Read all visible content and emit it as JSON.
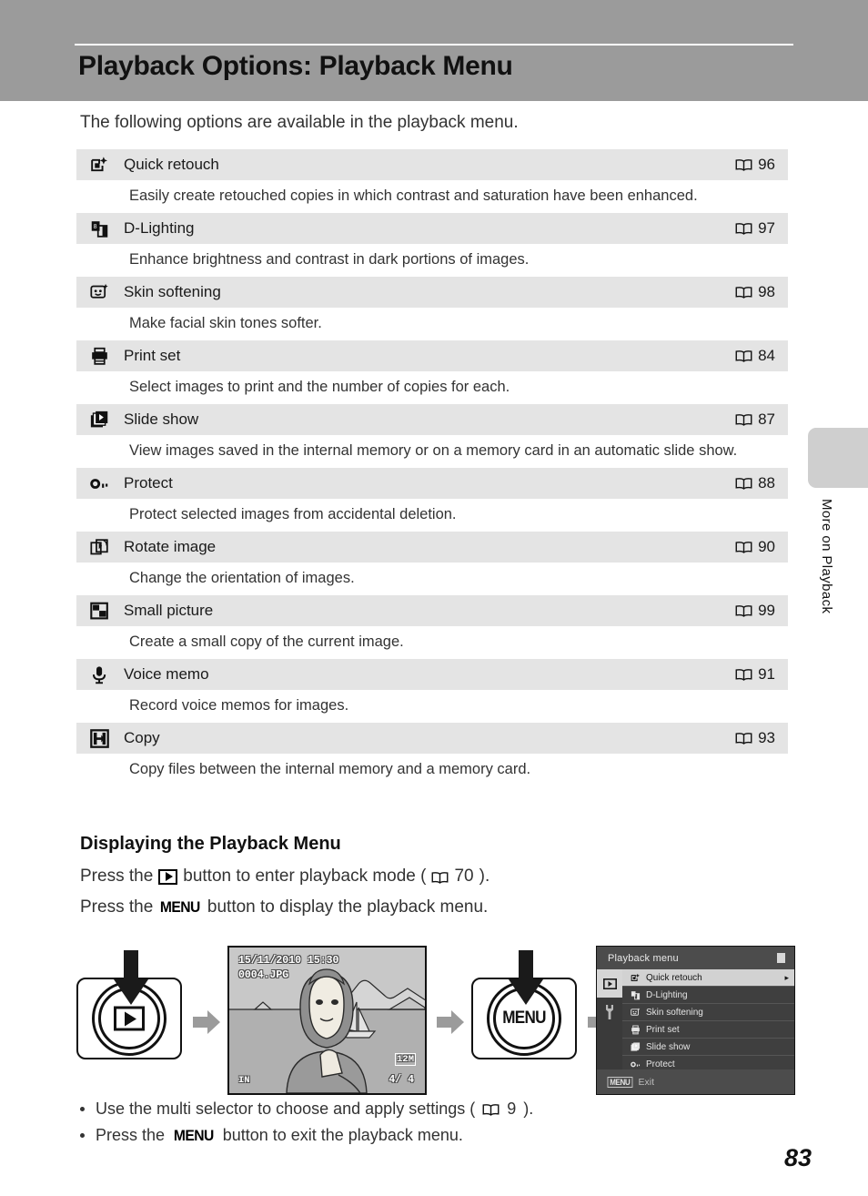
{
  "header": {
    "title": "Playback Options: Playback Menu",
    "band_color": "#9b9b9b"
  },
  "intro": "The following options are available in the playback menu.",
  "options_table": {
    "rows": [
      {
        "icon": "quick-retouch-icon",
        "label": "Quick retouch",
        "page": "96",
        "description": "Easily create retouched copies in which contrast and saturation have been enhanced."
      },
      {
        "icon": "d-lighting-icon",
        "label": "D-Lighting",
        "page": "97",
        "description": "Enhance brightness and contrast in dark portions of images."
      },
      {
        "icon": "skin-softening-icon",
        "label": "Skin softening",
        "page": "98",
        "description": "Make facial skin tones softer."
      },
      {
        "icon": "print-set-icon",
        "label": "Print set",
        "page": "84",
        "description": "Select images to print and the number of copies for each."
      },
      {
        "icon": "slide-show-icon",
        "label": "Slide show",
        "page": "87",
        "description": "View images saved in the internal memory or on a memory card in an automatic slide show."
      },
      {
        "icon": "protect-key-icon",
        "label": "Protect",
        "page": "88",
        "description": "Protect selected images from accidental deletion."
      },
      {
        "icon": "rotate-image-icon",
        "label": "Rotate image",
        "page": "90",
        "description": "Change the orientation of images."
      },
      {
        "icon": "small-picture-icon",
        "label": "Small picture",
        "page": "99",
        "description": "Create a small copy of the current image."
      },
      {
        "icon": "voice-memo-icon",
        "label": "Voice memo",
        "page": "91",
        "description": "Record voice memos for images."
      },
      {
        "icon": "copy-icon",
        "label": "Copy",
        "page": "93",
        "description": "Copy files between the internal memory and a memory card."
      }
    ]
  },
  "section": {
    "heading": "Displaying the Playback Menu",
    "line1_pre": "Press the",
    "line1_mid": "button to enter playback mode (",
    "line1_page": "70",
    "line1_post": ").",
    "line2_pre": "Press the",
    "line2_menu": "MENU",
    "line2_post": "button to display the playback menu."
  },
  "figure": {
    "play_button_label": "",
    "menu_button_label": "MENU",
    "camera_screen": {
      "date": "15/11/2010 15:30",
      "filename": "0004.JPG",
      "image_size": "12M",
      "memory": "IN",
      "counter": "4/  4"
    },
    "menu_screen": {
      "title": "Playback menu",
      "items": [
        {
          "icon": "quick-retouch-icon",
          "label": "Quick retouch",
          "selected": true,
          "arrow": "▸"
        },
        {
          "icon": "d-lighting-icon",
          "label": "D-Lighting",
          "selected": false,
          "arrow": ""
        },
        {
          "icon": "skin-softening-icon",
          "label": "Skin softening",
          "selected": false,
          "arrow": ""
        },
        {
          "icon": "print-set-icon",
          "label": "Print set",
          "selected": false,
          "arrow": ""
        },
        {
          "icon": "slide-show-icon",
          "label": "Slide show",
          "selected": false,
          "arrow": ""
        },
        {
          "icon": "protect-key-icon",
          "label": "Protect",
          "selected": false,
          "arrow": ""
        }
      ],
      "footer_chip": "MENU",
      "footer_label": "Exit"
    }
  },
  "bullets": [
    {
      "pre": "Use the multi selector to choose and apply settings (",
      "page": "9",
      "post": ")."
    },
    {
      "pre": "Press the",
      "menu": "MENU",
      "post": "button to exit the playback menu."
    }
  ],
  "side_tab": {
    "label": "More on Playback"
  },
  "page_number": "83"
}
